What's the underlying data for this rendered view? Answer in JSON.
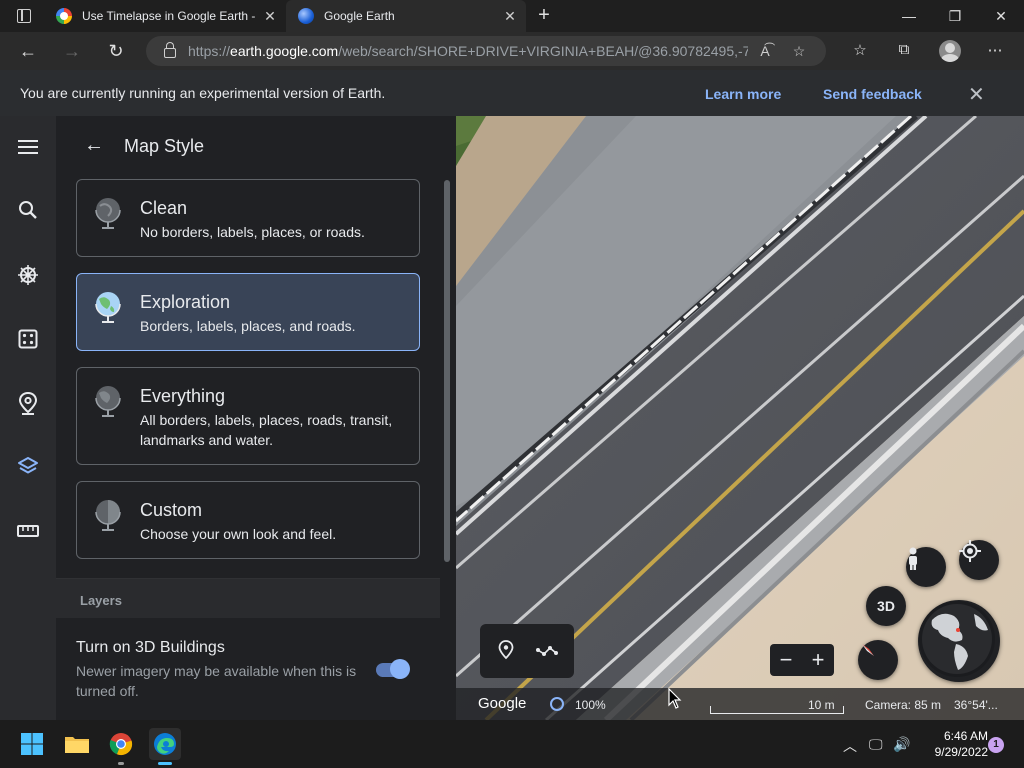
{
  "browser": {
    "tabs": [
      {
        "title": "Use Timelapse in Google Earth -",
        "favicon": "google-favicon"
      },
      {
        "title": "Google Earth",
        "favicon": "google-earth-favicon"
      }
    ],
    "url_prefix": "https://",
    "url_host": "earth.google.com",
    "url_rest": "/web/search/SHORE+DRIVE+VIRGINIA+BEAH/@36.90782495,-7..."
  },
  "banner": {
    "message": "You are currently running an experimental version of Earth.",
    "learn_more": "Learn more",
    "send_feedback": "Send feedback"
  },
  "rail": {
    "icons": [
      "menu-icon",
      "search-icon",
      "voyager-icon",
      "projects-icon",
      "places-icon",
      "map-style-icon",
      "measure-icon"
    ],
    "active": "map-style-icon",
    "accent": "#8ab4f8"
  },
  "panel": {
    "title": "Map Style",
    "styles": [
      {
        "name": "Clean",
        "desc": "No borders, labels, places, or roads.",
        "selected": false
      },
      {
        "name": "Exploration",
        "desc": "Borders, labels, places, and roads.",
        "selected": true
      },
      {
        "name": "Everything",
        "desc": "All borders, labels, places, roads, transit, landmarks and water.",
        "selected": false
      },
      {
        "name": "Custom",
        "desc": "Choose your own look and feel.",
        "selected": false
      }
    ],
    "layers_heading": "Layers",
    "buildings_title": "Turn on 3D Buildings",
    "buildings_desc": "Newer imagery may be available when this is turned off.",
    "buildings_on": true
  },
  "map": {
    "btn_3d": "3D",
    "google_logo": "Google",
    "load_percent": "100%",
    "scale_label": "10 m",
    "camera": "Camera: 85 m",
    "coords": "36°54'..."
  },
  "taskbar": {
    "apps": [
      "windows-start-icon",
      "file-explorer-icon",
      "chrome-icon",
      "edge-icon"
    ],
    "time": "6:46 AM",
    "date": "9/29/2022",
    "notifications": "1"
  }
}
